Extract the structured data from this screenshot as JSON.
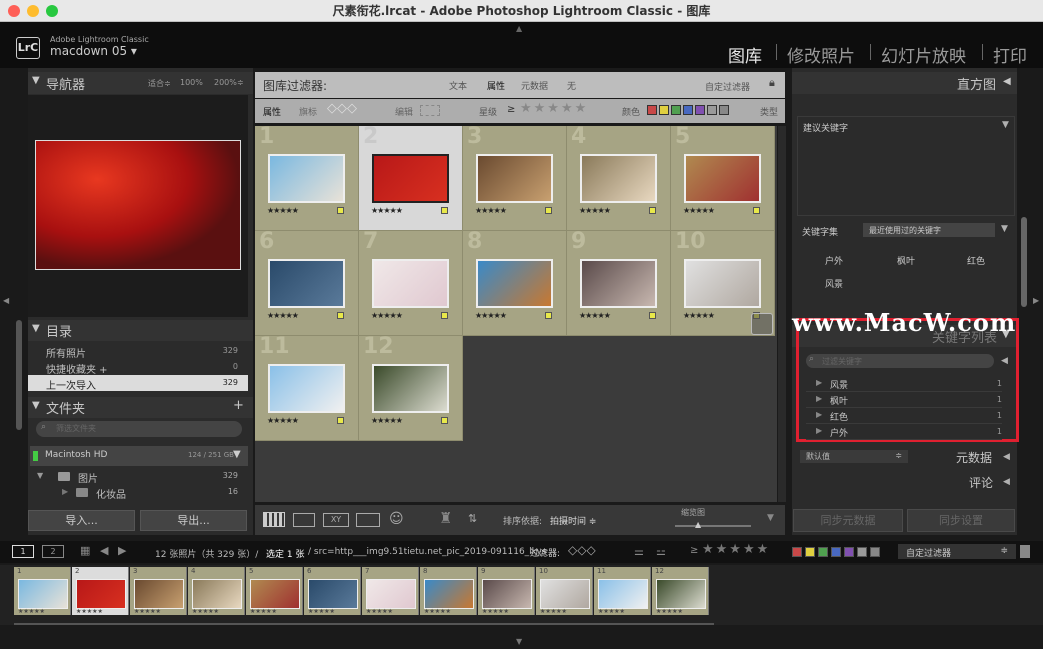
{
  "window": {
    "title": "尺素衔花.lrcat - Adobe Photoshop Lightroom Classic - 图库"
  },
  "identity": {
    "logo": "LrC",
    "app_name": "Adobe Lightroom Classic",
    "catalog_name": "macdown 05"
  },
  "modules": [
    "图库",
    "修改照片",
    "幻灯片放映",
    "打印"
  ],
  "navigator": {
    "title": "导航器",
    "zoom_options": [
      "适合",
      "100%",
      "200%"
    ]
  },
  "catalog": {
    "title": "目录",
    "items": [
      {
        "label": "所有照片",
        "count": "329"
      },
      {
        "label": "快捷收藏夹 +",
        "count": "0"
      },
      {
        "label": "上一次导入",
        "count": "329"
      }
    ]
  },
  "folders": {
    "title": "文件夹",
    "plus": "+",
    "search_placeholder": "筛选文件夹",
    "volume": {
      "name": "Macintosh HD",
      "space": "124 / 251 GB"
    },
    "items": [
      {
        "label": "图片",
        "count": "329"
      },
      {
        "label": "化妆品",
        "count": "16"
      }
    ]
  },
  "left_buttons": {
    "import": "导入...",
    "export": "导出..."
  },
  "filter_bar": {
    "title": "图库过滤器:",
    "tabs": [
      "文本",
      "属性",
      "元数据",
      "无"
    ],
    "preset": "自定过滤器"
  },
  "attr_bar": {
    "attr_label": "属性",
    "flag_label": "旗标",
    "edit_label": "编辑",
    "rating_label": "星级",
    "gte": "≥",
    "stars": "★★★★★",
    "color_label": "颜色",
    "type_label": "类型",
    "swatches": [
      "#c84848",
      "#e0d040",
      "#50a050",
      "#4868c0",
      "#8050b0",
      "#9a9a9a",
      "#888888"
    ]
  },
  "photos": [
    {
      "num": "1",
      "stars": "★★★★★",
      "colors": [
        "#7ab8e0",
        "#e8e2d8"
      ]
    },
    {
      "num": "2",
      "stars": "★★★★★",
      "colors": [
        "#b81818",
        "#d83020"
      ]
    },
    {
      "num": "3",
      "stars": "★★★★★",
      "colors": [
        "#6a4a30",
        "#c8a070"
      ]
    },
    {
      "num": "4",
      "stars": "★★★★★",
      "colors": [
        "#8a7a5a",
        "#e8d8c0"
      ]
    },
    {
      "num": "5",
      "stars": "★★★★★",
      "colors": [
        "#b08a50",
        "#a03030"
      ]
    },
    {
      "num": "6",
      "stars": "★★★★★",
      "colors": [
        "#2a4a6a",
        "#5a7a9a"
      ]
    },
    {
      "num": "7",
      "stars": "★★★★★",
      "colors": [
        "#f0e8e8",
        "#e0c8d0"
      ]
    },
    {
      "num": "8",
      "stars": "★★★★★",
      "colors": [
        "#3a8ac8",
        "#c87830"
      ]
    },
    {
      "num": "9",
      "stars": "★★★★★",
      "colors": [
        "#5a4a4a",
        "#c8b8b0"
      ]
    },
    {
      "num": "10",
      "stars": "★★★★★",
      "colors": [
        "#e0e0e0",
        "#b0a8a0"
      ]
    },
    {
      "num": "11",
      "stars": "★★★★★",
      "colors": [
        "#8ac0e8",
        "#f0f0f0"
      ]
    },
    {
      "num": "12",
      "stars": "★★★★★",
      "colors": [
        "#3a4a2a",
        "#dcdcd0"
      ]
    }
  ],
  "toolbar": {
    "sort_label": "排序依据:",
    "sort_value": "拍摄时间",
    "thumb_label": "缩览图"
  },
  "right": {
    "histogram": "直方图",
    "keyword_suggest": "建议关键字",
    "keyword_set_label": "关键字集",
    "keyword_set_value": "最近使用过的关键字",
    "keyword_set_items": [
      "户外",
      "枫叶",
      "红色",
      "风景"
    ],
    "keyword_list_title": "关键字列表",
    "keyword_filter_placeholder": "过滤关键字",
    "keywords": [
      {
        "label": "风景",
        "count": "1"
      },
      {
        "label": "枫叶",
        "count": "1"
      },
      {
        "label": "红色",
        "count": "1"
      },
      {
        "label": "户外",
        "count": "1"
      }
    ],
    "metadata_preset": "默认值",
    "metadata_title": "元数据",
    "comments_title": "评论",
    "sync_metadata": "同步元数据",
    "sync_settings": "同步设置"
  },
  "watermark": "www.MacW.com",
  "filmstrip_bar": {
    "page1": "1",
    "page2": "2",
    "info_a": "12 张照片（共 329 张）/",
    "info_b": "选定 1 张",
    "info_c": "/ src=http___img9.51tietu.net_pic_2019-091116_lkys",
    "filter_label": "过滤器:",
    "gte": "≥",
    "stars": "★★★★★",
    "preset": "自定过滤器"
  }
}
